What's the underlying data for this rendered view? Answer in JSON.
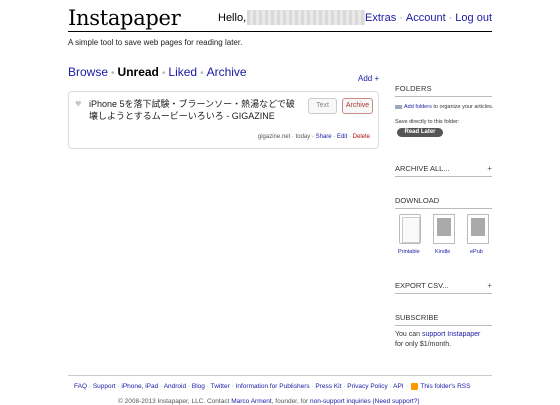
{
  "header": {
    "logo": "Instapaper",
    "hello": "Hello,",
    "nav": [
      "Extras",
      "Account",
      "Log out"
    ]
  },
  "tagline": "A simple tool to save web pages for reading later.",
  "tabs": [
    "Browse",
    "Unread",
    "Liked",
    "Archive"
  ],
  "active_tab": "Unread",
  "add_link": "Add +",
  "article": {
    "title": "iPhone 5を落下試験・ブラーンソー・熱湯などで破壊しようとするムービーいろいろ - GIGAZINE",
    "text_button": "Text",
    "archive_button": "Archive",
    "source": "gigazine.net",
    "time": "today",
    "share": "Share",
    "edit": "Edit",
    "delete": "Delete"
  },
  "sidebar": {
    "folders_heading": "FOLDERS",
    "add_folders_link": "Add folders",
    "add_folders_rest": "to organize your articles.",
    "save_directly": "Save directly to this folder:",
    "read_later_pill": "Read Later",
    "archive_all": "ARCHIVE ALL...",
    "download_heading": "DOWNLOAD",
    "downloads": [
      "Printable",
      "Kindle",
      "ePub"
    ],
    "export_csv": "EXPORT CSV...",
    "subscribe_heading": "SUBSCRIBE",
    "support_text_1": "You can",
    "support_link": "support Instapaper",
    "support_text_2": "for only $1/month.",
    "plus": "+"
  },
  "footer": {
    "links": [
      "FAQ",
      "Support",
      "iPhone, iPad",
      "Android",
      "Blog",
      "Twitter",
      "Information for Publishers",
      "Press Kit",
      "Privacy Policy",
      "API"
    ],
    "rss_label": "This folder's RSS",
    "copyright": "© 2008-2013 Instapaper, LLC. Contact",
    "contact_name": "Marco Arment",
    "founder_text": ", founder, for",
    "permission_link": "non-support inquiries",
    "support_q": "(Need support?)"
  }
}
